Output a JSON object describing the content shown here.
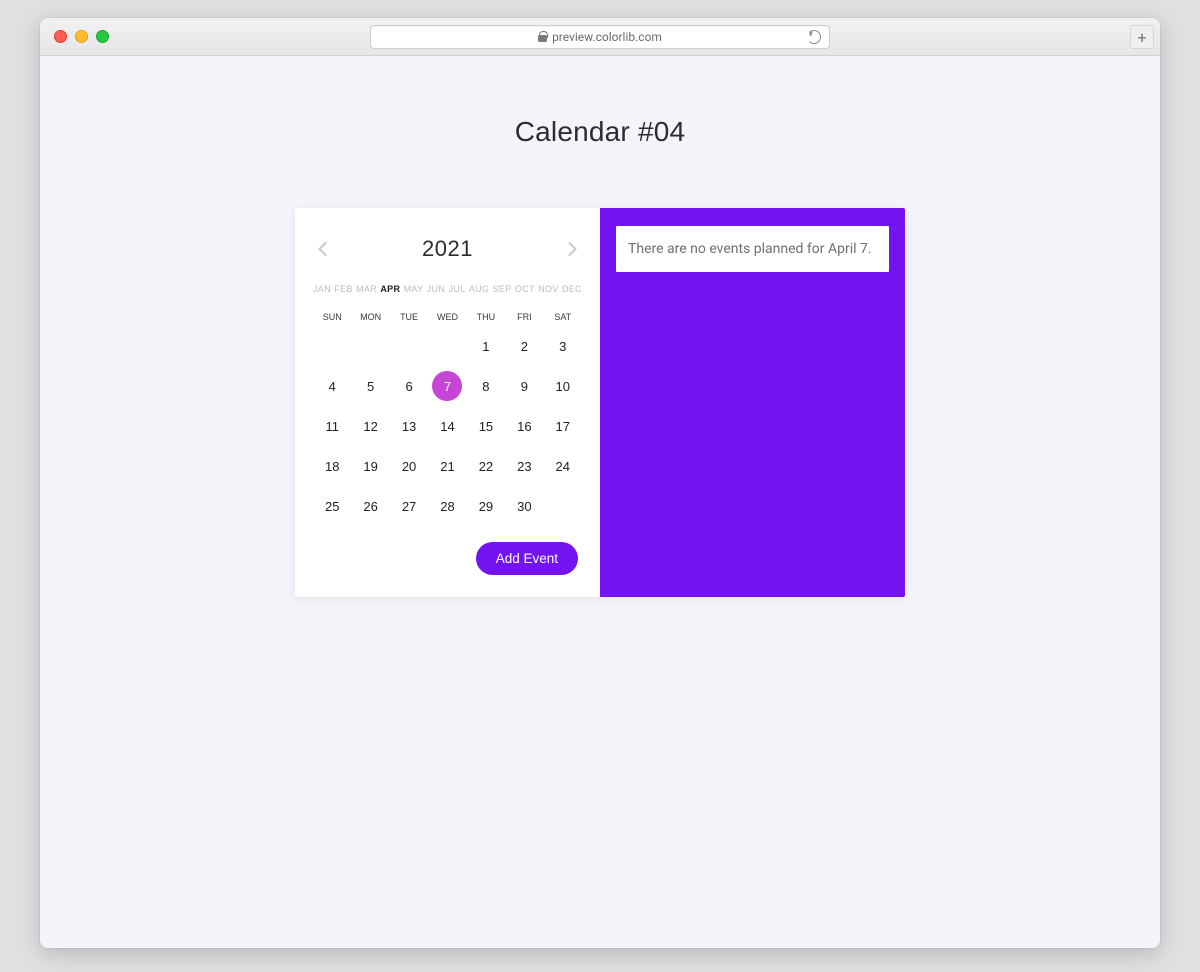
{
  "browser": {
    "url_display": "preview.colorlib.com"
  },
  "page": {
    "heading": "Calendar #04"
  },
  "calendar": {
    "year": "2021",
    "months": [
      "JAN",
      "FEB",
      "MAR",
      "APR",
      "MAY",
      "JUN",
      "JUL",
      "AUG",
      "SEP",
      "OCT",
      "NOV",
      "DEC"
    ],
    "active_month_index": 3,
    "dow": [
      "SUN",
      "MON",
      "TUE",
      "WED",
      "THU",
      "FRI",
      "SAT"
    ],
    "leading_blanks": 4,
    "days_in_month": 30,
    "selected_day": 7,
    "add_event_label": "Add Event"
  },
  "events": {
    "empty_message": "There are no events planned for April 7."
  }
}
